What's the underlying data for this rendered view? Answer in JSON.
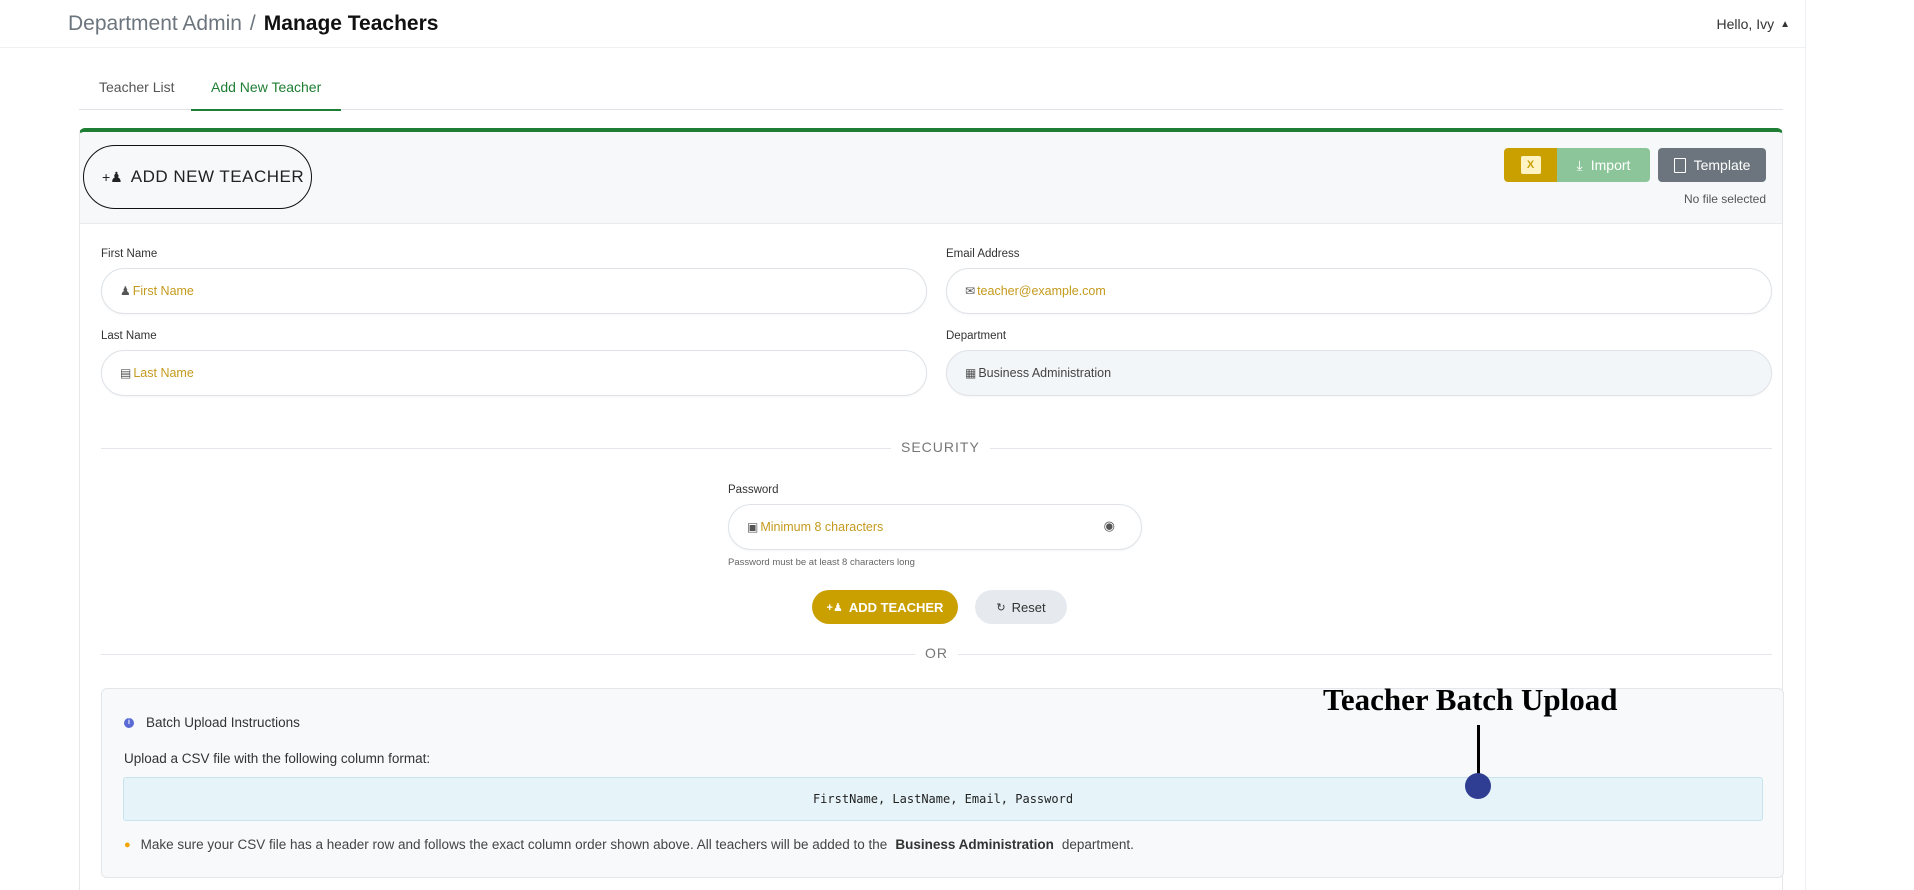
{
  "header": {
    "breadcrumb_parent": "Department Admin",
    "breadcrumb_sep": "/",
    "breadcrumb_current": "Manage Teachers",
    "greeting": "Hello, Ivy",
    "caret_icon": "chevron-up-icon"
  },
  "tabs": [
    {
      "label": "Teacher List",
      "active": false
    },
    {
      "label": "Add New Teacher",
      "active": true
    }
  ],
  "card": {
    "title": "ADD NEW TEACHER",
    "excel_icon_text": "X",
    "import_label": "Import",
    "template_label": "Template",
    "file_status": "No file selected"
  },
  "form": {
    "first_name": {
      "label": "First Name",
      "placeholder": "First Name",
      "value": ""
    },
    "email": {
      "label": "Email Address",
      "placeholder": "teacher@example.com",
      "value": ""
    },
    "last_name": {
      "label": "Last Name",
      "placeholder": "Last Name",
      "value": ""
    },
    "department": {
      "label": "Department",
      "value": "Business Administration"
    },
    "security_heading": "SECURITY",
    "password": {
      "label": "Password",
      "placeholder": "Minimum 8 characters",
      "hint": "Password must be at least 8 characters long"
    },
    "add_button": "ADD TEACHER",
    "reset_button": "Reset",
    "or_divider": "OR"
  },
  "batch": {
    "title": "Batch Upload Instructions",
    "subtitle": "Upload a CSV file with the following column format:",
    "columns": "FirstName, LastName, Email, Password",
    "tip_pre": "Make sure your CSV file has a header row and follows the exact column order shown above. All teachers will be added to the",
    "tip_bold": "Business Administration",
    "tip_post": "department."
  },
  "annotation": {
    "label": "Teacher Batch Upload"
  },
  "colors": {
    "accent_green": "#1e7e34",
    "gold": "#c9a000",
    "import_green": "#8cc59a",
    "template_gray": "#6c757d",
    "annotation_dot": "#2f3e92"
  }
}
